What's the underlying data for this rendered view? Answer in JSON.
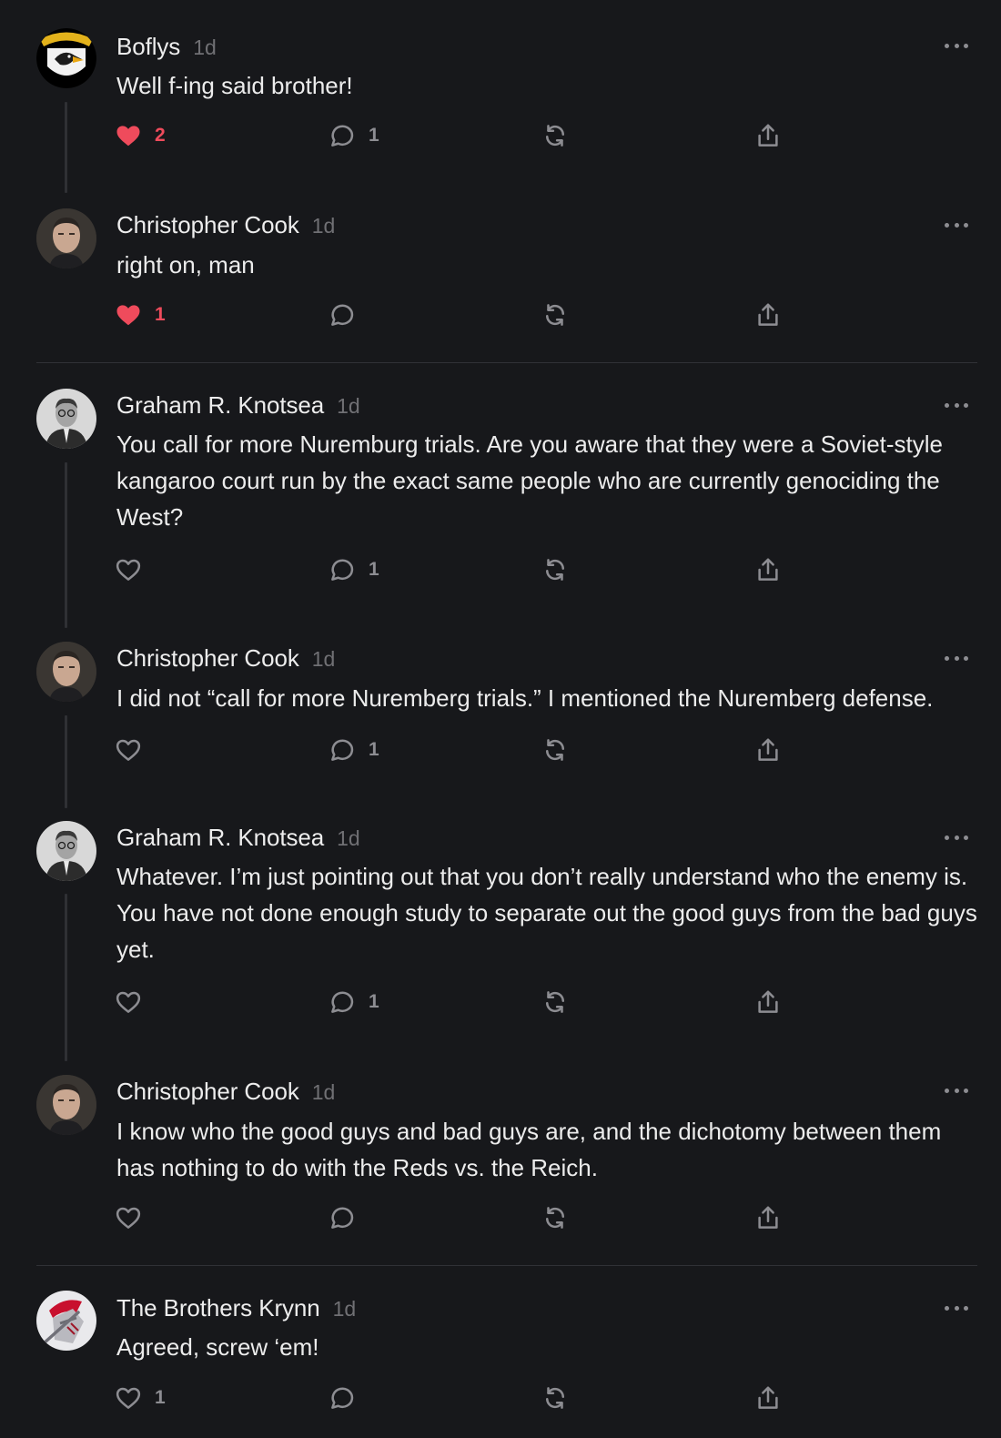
{
  "comments": [
    {
      "author": "Boflys",
      "time": "1d",
      "avatar_icon": "airborne-eagle-avatar-icon",
      "text": "Well f-ing said brother!",
      "likes": "2",
      "liked": true,
      "replies": "1"
    },
    {
      "author": "Christopher Cook",
      "time": "1d",
      "avatar_icon": "man-portrait-avatar-icon",
      "text": "right on, man",
      "likes": "1",
      "liked": true,
      "replies": ""
    },
    {
      "author": "Graham R. Knotsea",
      "time": "1d",
      "avatar_icon": "bw-portrait-avatar-icon",
      "text": "You call for more Nuremburg trials. Are you aware that they were a Soviet-style kangaroo court run by the exact same people who are currently genociding the West?",
      "likes": "",
      "liked": false,
      "replies": "1"
    },
    {
      "author": "Christopher Cook",
      "time": "1d",
      "avatar_icon": "man-portrait-avatar-icon",
      "text": "I did not “call for more Nuremberg trials.” I mentioned the Nuremberg defense.",
      "likes": "",
      "liked": false,
      "replies": "1"
    },
    {
      "author": "Graham R. Knotsea",
      "time": "1d",
      "avatar_icon": "bw-portrait-avatar-icon",
      "text": "Whatever. I’m just pointing out that you don’t really understand who the enemy is. You have not done enough study to separate out the good guys from the bad guys yet.",
      "likes": "",
      "liked": false,
      "replies": "1"
    },
    {
      "author": "Christopher Cook",
      "time": "1d",
      "avatar_icon": "man-portrait-avatar-icon",
      "text": "I know who the good guys and bad guys are, and the dichotomy between them has nothing to do with the Reds vs. the Reich.",
      "likes": "",
      "liked": false,
      "replies": ""
    },
    {
      "author": "The Brothers Krynn",
      "time": "1d",
      "avatar_icon": "knight-avatar-icon",
      "text": "Agreed, screw ‘em!",
      "likes": "1",
      "liked": false,
      "replies": ""
    }
  ],
  "colors": {
    "background": "#17181b",
    "like_active": "#ef4b5c",
    "icon_muted": "#8d8d92",
    "thread_line": "#2f3034"
  }
}
